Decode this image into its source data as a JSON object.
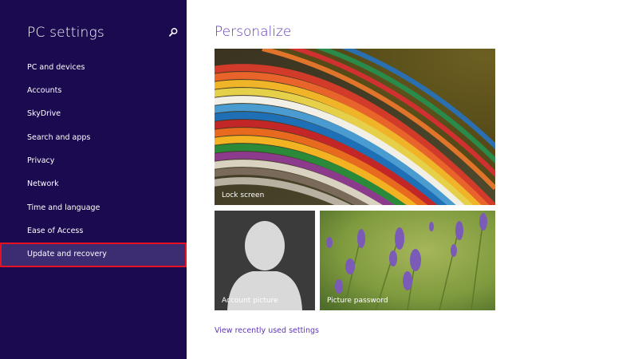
{
  "sidebar": {
    "title": "PC settings",
    "search_icon": "search-icon",
    "items": [
      {
        "label": "PC and devices"
      },
      {
        "label": "Accounts"
      },
      {
        "label": "SkyDrive"
      },
      {
        "label": "Search and apps"
      },
      {
        "label": "Privacy"
      },
      {
        "label": "Network"
      },
      {
        "label": "Time and language"
      },
      {
        "label": "Ease of Access"
      },
      {
        "label": "Update and recovery",
        "selected": true
      }
    ]
  },
  "main": {
    "title": "Personalize",
    "tiles": {
      "lock_screen": {
        "label": "Lock screen"
      },
      "account_picture": {
        "label": "Account picture"
      },
      "picture_password": {
        "label": "Picture password"
      }
    },
    "recent_link": "View recently used settings"
  },
  "colors": {
    "sidebar_bg": "#1b0a50",
    "selected_bg": "#3c2d72",
    "highlight_border": "#e81123",
    "accent": "#5d35b7"
  }
}
